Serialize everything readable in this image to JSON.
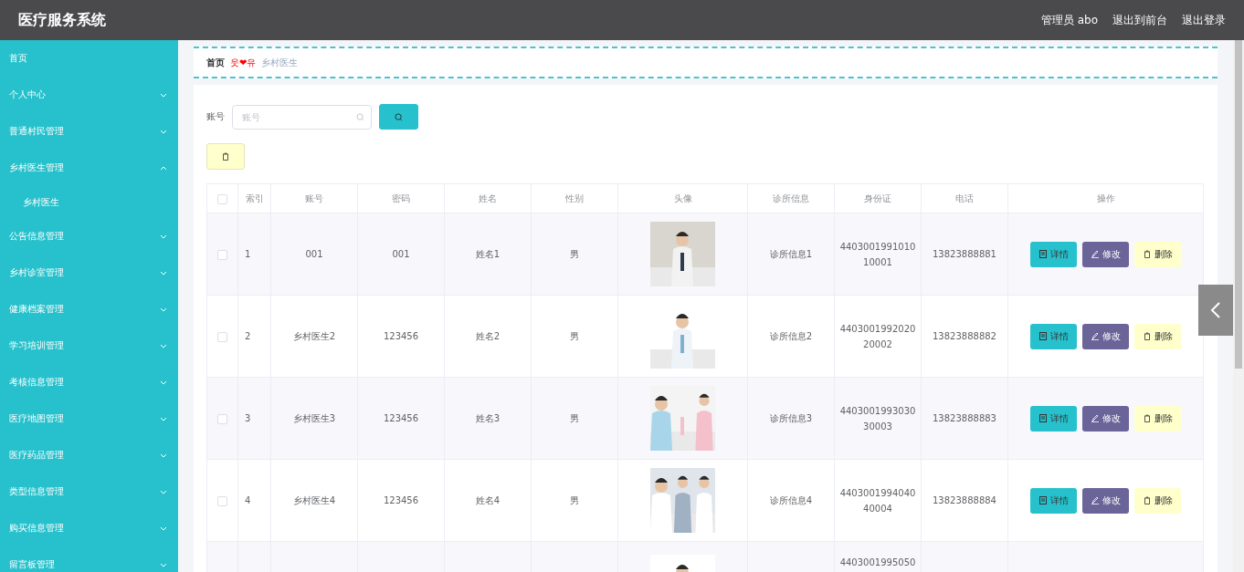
{
  "header": {
    "title": "医疗服务系统",
    "user": "管理员 abo",
    "links": [
      "退出到前台",
      "退出登录"
    ]
  },
  "sidebar": {
    "items": [
      {
        "label": "首页"
      },
      {
        "label": "个人中心",
        "expanded": false
      },
      {
        "label": "普通村民管理",
        "expanded": false
      },
      {
        "label": "乡村医生管理",
        "expanded": true,
        "children": [
          {
            "label": "乡村医生"
          }
        ]
      },
      {
        "label": "公告信息管理",
        "expanded": false
      },
      {
        "label": "乡村诊室管理",
        "expanded": false
      },
      {
        "label": "健康档案管理",
        "expanded": false
      },
      {
        "label": "学习培训管理",
        "expanded": false
      },
      {
        "label": "考核信息管理",
        "expanded": false
      },
      {
        "label": "医疗地图管理",
        "expanded": false
      },
      {
        "label": "医疗药品管理",
        "expanded": false
      },
      {
        "label": "类型信息管理",
        "expanded": false
      },
      {
        "label": "购买信息管理",
        "expanded": false
      },
      {
        "label": "留言板管理",
        "expanded": false
      }
    ]
  },
  "breadcrumb": {
    "items": [
      "首页",
      "乡村医生"
    ],
    "separator": "웃❤유"
  },
  "search": {
    "label": "账号",
    "placeholder": "账号"
  },
  "table": {
    "columns": [
      "索引",
      "账号",
      "密码",
      "姓名",
      "性别",
      "头像",
      "诊所信息",
      "身份证",
      "电话",
      "操作"
    ],
    "header_checked": false,
    "rows": [
      {
        "checked": false,
        "cells": [
          "1",
          "001",
          "001",
          "姓名1",
          "男",
          "",
          "诊所信息1",
          "440300199101010001",
          "13823888881"
        ],
        "actions": [
          "详情",
          "修改",
          "删除"
        ]
      },
      {
        "checked": false,
        "cells": [
          "2",
          "乡村医生2",
          "123456",
          "姓名2",
          "男",
          "",
          "诊所信息2",
          "440300199202020002",
          "13823888882"
        ],
        "actions": [
          "详情",
          "修改",
          "删除"
        ]
      },
      {
        "checked": false,
        "cells": [
          "3",
          "乡村医生3",
          "123456",
          "姓名3",
          "男",
          "",
          "诊所信息3",
          "440300199303030003",
          "13823888883"
        ],
        "actions": [
          "详情",
          "修改",
          "删除"
        ]
      },
      {
        "checked": false,
        "cells": [
          "4",
          "乡村医生4",
          "123456",
          "姓名4",
          "男",
          "",
          "诊所信息4",
          "440300199404040004",
          "13823888884"
        ],
        "actions": [
          "详情",
          "修改",
          "删除"
        ]
      },
      {
        "cells": [
          "",
          "",
          "",
          "",
          "",
          "",
          "",
          "4403001995050",
          ""
        ]
      }
    ]
  }
}
